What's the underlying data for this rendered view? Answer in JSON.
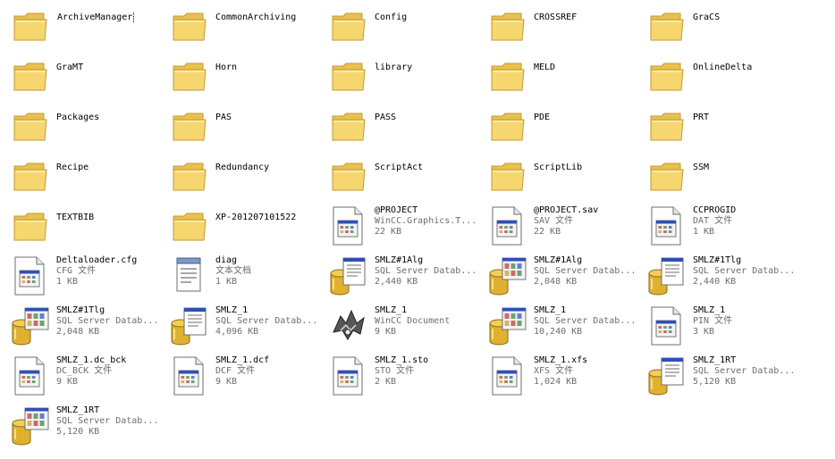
{
  "items": [
    {
      "name": "ArchiveManager",
      "type": "folder",
      "selected": true
    },
    {
      "name": "CommonArchiving",
      "type": "folder"
    },
    {
      "name": "Config",
      "type": "folder"
    },
    {
      "name": "CROSSREF",
      "type": "folder"
    },
    {
      "name": "GraCS",
      "type": "folder"
    },
    {
      "name": "GraMT",
      "type": "folder"
    },
    {
      "name": "Horn",
      "type": "folder"
    },
    {
      "name": "library",
      "type": "folder"
    },
    {
      "name": "MELD",
      "type": "folder"
    },
    {
      "name": "OnlineDelta",
      "type": "folder"
    },
    {
      "name": "Packages",
      "type": "folder"
    },
    {
      "name": "PAS",
      "type": "folder"
    },
    {
      "name": "PASS",
      "type": "folder"
    },
    {
      "name": "PDE",
      "type": "folder"
    },
    {
      "name": "PRT",
      "type": "folder"
    },
    {
      "name": "Recipe",
      "type": "folder"
    },
    {
      "name": "Redundancy",
      "type": "folder"
    },
    {
      "name": "ScriptAct",
      "type": "folder"
    },
    {
      "name": "ScriptLib",
      "type": "folder"
    },
    {
      "name": "SSM",
      "type": "folder"
    },
    {
      "name": "TEXTBIB",
      "type": "folder"
    },
    {
      "name": "XP-201207101522",
      "type": "folder"
    },
    {
      "name": "@PROJECT",
      "type": "window",
      "desc": "WinCC.Graphics.T...",
      "size": "22 KB"
    },
    {
      "name": "@PROJECT.sav",
      "type": "window",
      "desc": "SAV 文件",
      "size": "22 KB"
    },
    {
      "name": "CCPROGID",
      "type": "window",
      "desc": "DAT 文件",
      "size": "1 KB"
    },
    {
      "name": "Deltaloader.cfg",
      "type": "window",
      "desc": "CFG 文件",
      "size": "1 KB"
    },
    {
      "name": "diag",
      "type": "notepad",
      "desc": "文本文档",
      "size": "1 KB"
    },
    {
      "name": "SMLZ#1Alg",
      "type": "db-doc",
      "desc": "SQL Server Datab...",
      "size": "2,440 KB"
    },
    {
      "name": "SMLZ#1Alg",
      "type": "db-win",
      "desc": "SQL Server Datab...",
      "size": "2,048 KB"
    },
    {
      "name": "SMLZ#1Tlg",
      "type": "db-doc",
      "desc": "SQL Server Datab...",
      "size": "2,440 KB"
    },
    {
      "name": "SMLZ#1Tlg",
      "type": "db-win",
      "desc": "SQL Server Datab...",
      "size": "2,048 KB"
    },
    {
      "name": "SMLZ_1",
      "type": "db-doc",
      "desc": "SQL Server Datab...",
      "size": "4,096 KB"
    },
    {
      "name": "SMLZ_1",
      "type": "wincc",
      "desc": "WinCC Document",
      "size": "9 KB"
    },
    {
      "name": "SMLZ_1",
      "type": "db-win",
      "desc": "SQL Server Datab...",
      "size": "10,240 KB"
    },
    {
      "name": "SMLZ_1",
      "type": "window",
      "desc": "PIN 文件",
      "size": "3 KB"
    },
    {
      "name": "SMLZ_1.dc_bck",
      "type": "window",
      "desc": "DC_BCK 文件",
      "size": "9 KB"
    },
    {
      "name": "SMLZ_1.dcf",
      "type": "window",
      "desc": "DCF 文件",
      "size": "9 KB"
    },
    {
      "name": "SMLZ_1.sto",
      "type": "window",
      "desc": "STO 文件",
      "size": "2 KB"
    },
    {
      "name": "SMLZ_1.xfs",
      "type": "window",
      "desc": "XFS 文件",
      "size": "1,024 KB"
    },
    {
      "name": "SMLZ_1RT",
      "type": "db-doc",
      "desc": "SQL Server Datab...",
      "size": "5,120 KB"
    },
    {
      "name": "SMLZ_1RT",
      "type": "db-win",
      "desc": "SQL Server Datab...",
      "size": "5,120 KB"
    }
  ],
  "icon_names": {
    "folder": "folder-icon",
    "window": "file-icon",
    "notepad": "text-file-icon",
    "db-doc": "database-document-icon",
    "db-win": "database-window-icon",
    "wincc": "wincc-document-icon"
  },
  "colors": {
    "folder_fill": "#f5d66f",
    "folder_edge": "#c49b2c",
    "db_cylinder": "#e0b030",
    "window_title": "#2f4fb8",
    "secondary_text": "#6d6d6d"
  }
}
